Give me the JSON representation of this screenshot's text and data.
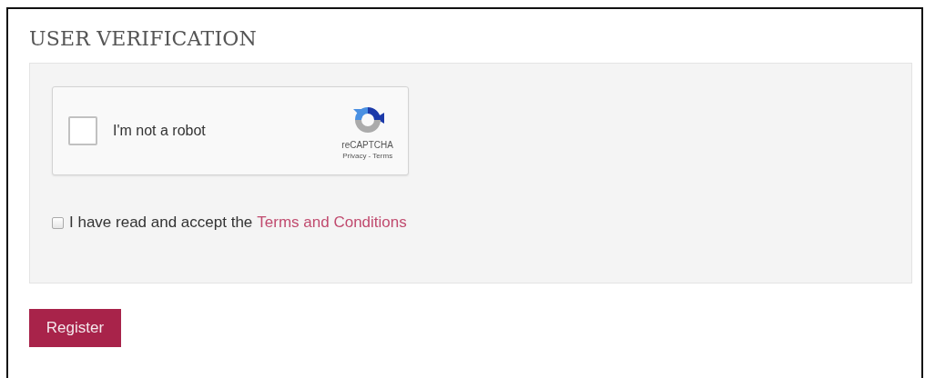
{
  "title": "USER VERIFICATION",
  "captcha": {
    "label": "I'm not a robot",
    "checked": false,
    "brand": "reCAPTCHA",
    "links": "Privacy - Terms"
  },
  "terms": {
    "text": "I have read and accept the",
    "link": "Terms and Conditions",
    "checked": false
  },
  "submit": "Register"
}
